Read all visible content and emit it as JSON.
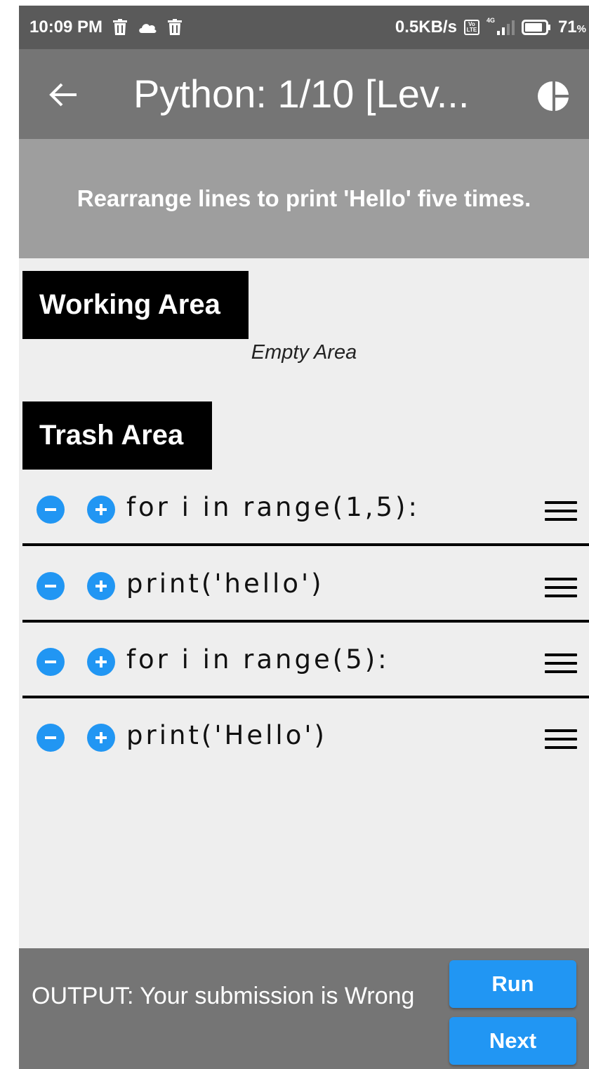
{
  "status_bar": {
    "time": "10:09 PM",
    "network_speed": "0.5KB/s",
    "volte": "Vo LTE",
    "network_type": "4G",
    "battery_percent": "71",
    "percent_sign": "%"
  },
  "app_bar": {
    "title": "Python: 1/10 [Lev..."
  },
  "instruction": "Rearrange lines to print 'Hello' five times.",
  "working_area": {
    "label": "Working Area",
    "empty_text": "Empty Area"
  },
  "trash_area": {
    "label": "Trash Area",
    "lines": [
      "for i in range(1,5):",
      "print('hello')",
      "for i in range(5):",
      "print('Hello')"
    ]
  },
  "bottom": {
    "output": "OUTPUT: Your submission is Wrong",
    "run_label": "Run",
    "next_label": "Next"
  },
  "colors": {
    "accent": "#2196f3",
    "app_bar": "#757575",
    "status_bar": "#5a5a5a",
    "banner": "#9e9e9e"
  }
}
